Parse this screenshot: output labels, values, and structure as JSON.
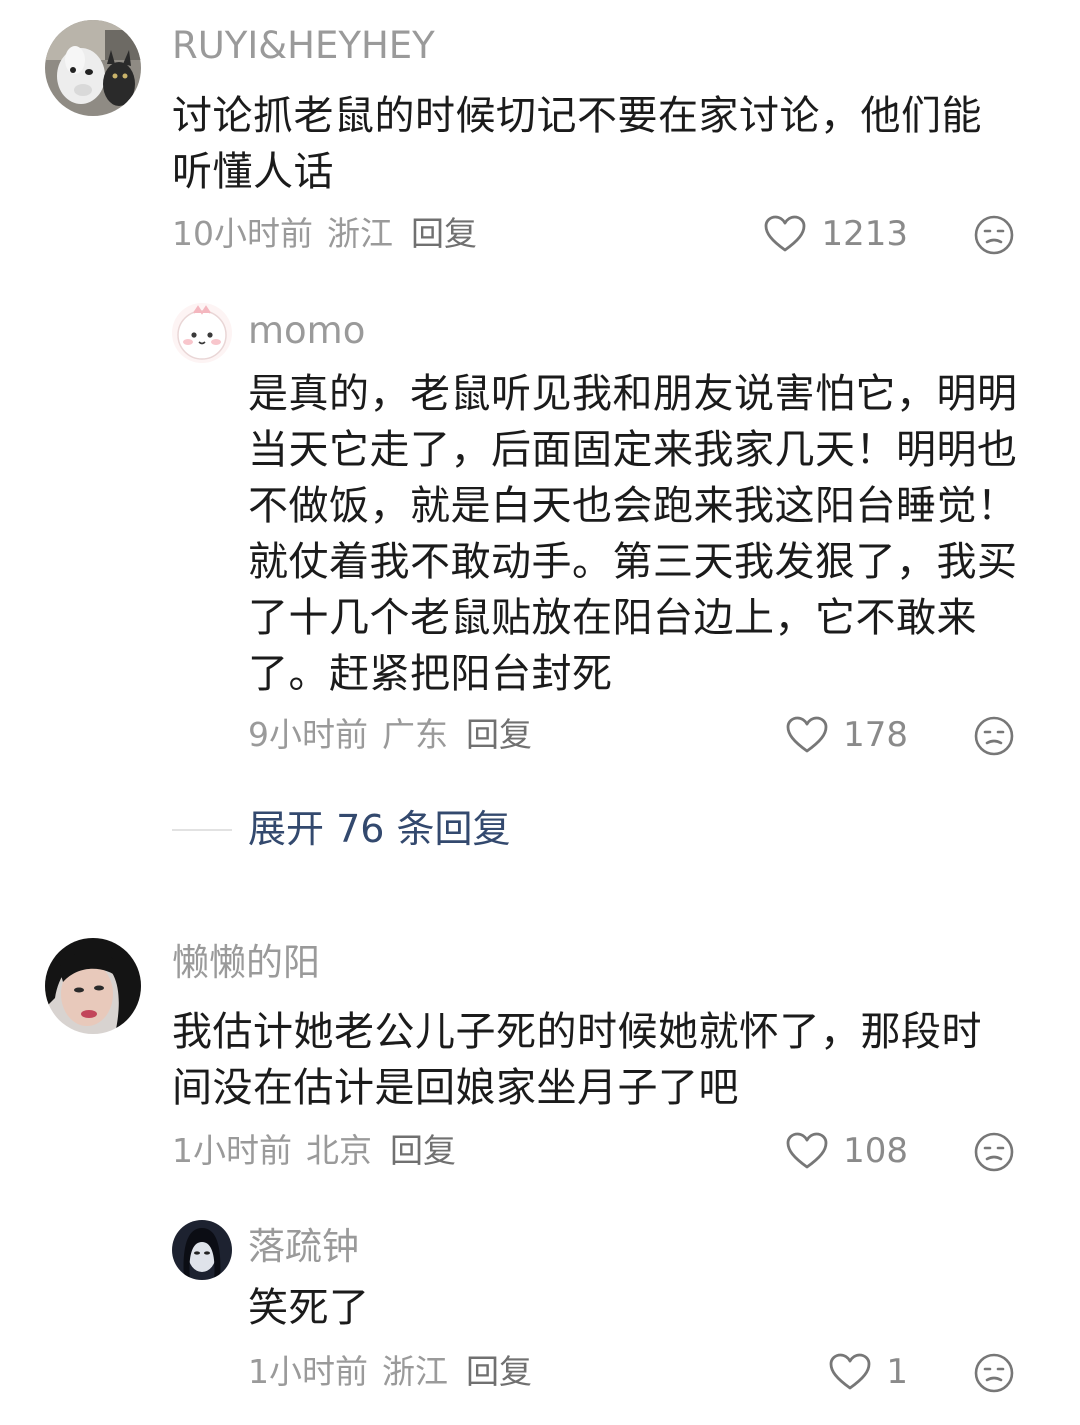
{
  "comments": [
    {
      "username": "RUYI&HEYHEY",
      "avatar_icon": "dog-cat-photo-avatar",
      "text": "讨论抓老鼠的时候切记不要在家讨论，他们能听懂人话",
      "time": "10小时前",
      "location": "浙江",
      "reply_label": "回复",
      "likes": "1213"
    },
    {
      "username": "momo",
      "avatar_icon": "cartoon-dinosaur-avatar",
      "text": "是真的，老鼠听见我和朋友说害怕它，明明当天它走了，后面固定来我家几天！明明也不做饭，就是白天也会跑来我这阳台睡觉！就仗着我不敢动手。第三天我发狠了，我买了十几个老鼠贴放在阳台边上，它不敢来了。赶紧把阳台封死",
      "time": "9小时前",
      "location": "广东",
      "reply_label": "回复",
      "likes": "178"
    },
    {
      "username": "懒懒的阳",
      "avatar_icon": "woman-portrait-avatar",
      "text": "我估计她老公儿子死的时候她就怀了，那段时间没在估计是回娘家坐月子了吧",
      "time": "1小时前",
      "location": "北京",
      "reply_label": "回复",
      "likes": "108"
    },
    {
      "username": "落疏钟",
      "avatar_icon": "dark-portrait-avatar",
      "text": "笑死了",
      "time": "1小时前",
      "location": "浙江",
      "reply_label": "回复",
      "likes": "1"
    }
  ],
  "expand_replies": {
    "label": "展开 76 条回复"
  },
  "colors": {
    "username": "#9a9a9a",
    "text": "#1b1b1b",
    "meta": "#9a9a9a",
    "expand": "#33496e"
  }
}
